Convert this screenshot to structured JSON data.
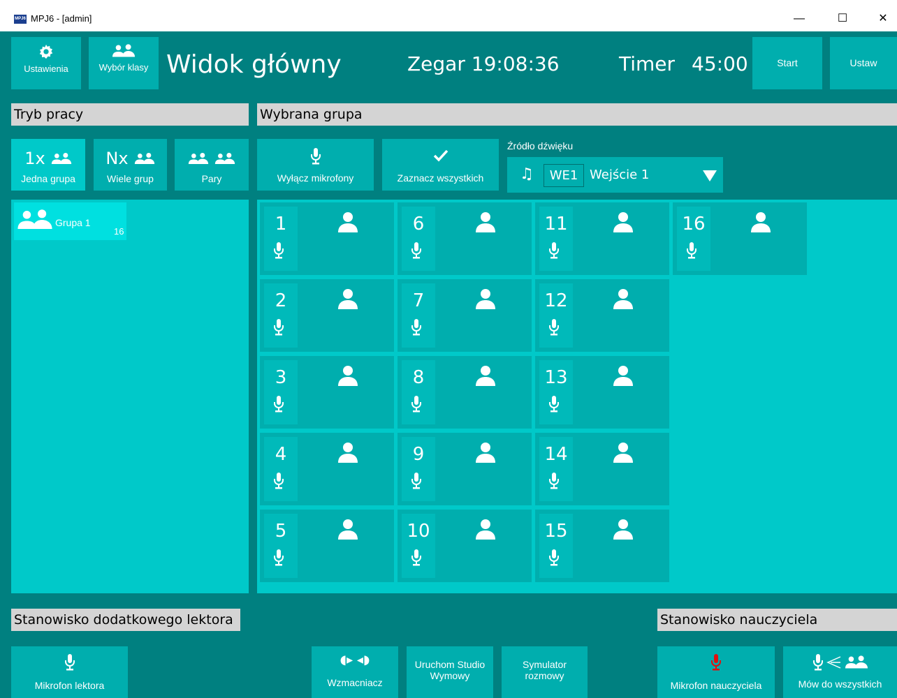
{
  "window": {
    "icon_text": "MPJ6",
    "title": "MPJ6 - [admin]",
    "min": "—",
    "max": "☐",
    "close": "✕"
  },
  "toolbar": {
    "settings": "Ustawienia",
    "class_select": "Wybór klasy",
    "page_title": "Widok główny",
    "clock": "Zegar 19:08:36",
    "timer_label": "Timer",
    "timer_value": "45:00",
    "start": "Start",
    "set": "Ustaw"
  },
  "sections": {
    "mode": "Tryb pracy",
    "selected_group": "Wybrana grupa",
    "extra_lector": "Stanowisko dodatkowego lektora",
    "teacher": "Stanowisko nauczyciela"
  },
  "modes": [
    {
      "prefix": "1x",
      "label": "Jedna grupa"
    },
    {
      "prefix": "Nx",
      "label": "Wiele grup"
    },
    {
      "prefix": "",
      "label": "Pary"
    }
  ],
  "actions": {
    "mute": "Wyłącz mikrofony",
    "select_all": "Zaznacz wszystkich"
  },
  "sound": {
    "label": "Źródło dźwięku",
    "code": "WE1",
    "name": "Wejście 1"
  },
  "group": {
    "name": "Grupa 1",
    "count": "16"
  },
  "students": [
    "1",
    "2",
    "3",
    "4",
    "5",
    "6",
    "7",
    "8",
    "9",
    "10",
    "11",
    "12",
    "13",
    "14",
    "15",
    "16"
  ],
  "bottom": {
    "lector_mic": "Mikrofon lektora",
    "amplifier": "Wzmacniacz",
    "studio": "Uruchom Studio Wymowy",
    "simulator": "Symulator rozmowy",
    "teacher_mic": "Mikrofon nauczyciela",
    "speak_all": "Mów do wszystkich"
  },
  "colors": {
    "bg": "#008080",
    "button": "#00aeae",
    "panel": "#00c9c9",
    "selected": "#00e0e0",
    "teacher_mic": "#e01010"
  }
}
